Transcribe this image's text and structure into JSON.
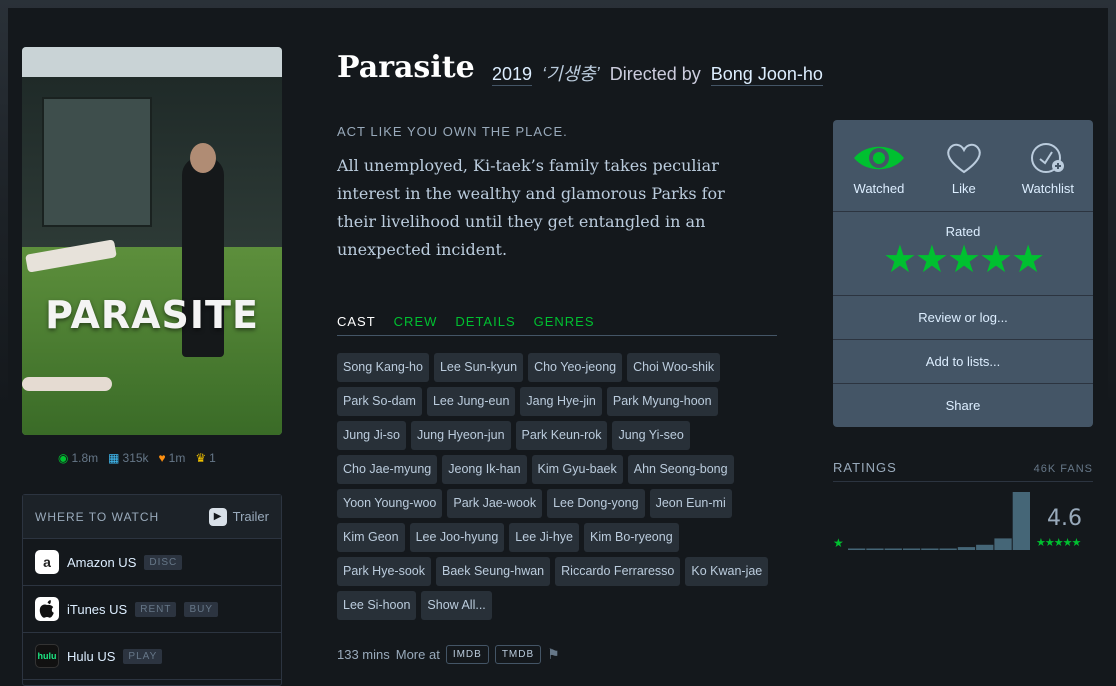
{
  "film": {
    "title": "Parasite",
    "year": "2019",
    "original_title": "‘기생충’",
    "directed_by_label": "Directed by",
    "director": "Bong Joon-ho",
    "tagline": "ACT LIKE YOU OWN THE PLACE.",
    "synopsis": "All unemployed, Ki-taek’s family takes peculiar interest in the wealthy and glamorous Parks for their livelihood until they get entangled in an unexpected incident."
  },
  "poster": {
    "title": "PARASITE"
  },
  "stats": {
    "watched": "1.8m",
    "lists": "315k",
    "likes": "1m",
    "top": "1"
  },
  "where_to_watch": {
    "title": "WHERE TO WATCH",
    "trailer_label": "Trailer",
    "services": [
      {
        "name": "Amazon US",
        "tags": [
          "DISC"
        ],
        "icon": "amazon-icon"
      },
      {
        "name": "iTunes US",
        "tags": [
          "RENT",
          "BUY"
        ],
        "icon": "apple-icon"
      },
      {
        "name": "Hulu US",
        "tags": [
          "PLAY"
        ],
        "icon": "hulu-icon"
      }
    ]
  },
  "tabs": [
    "CAST",
    "CREW",
    "DETAILS",
    "GENRES"
  ],
  "cast": [
    "Song Kang-ho",
    "Lee Sun-kyun",
    "Cho Yeo-jeong",
    "Choi Woo-shik",
    "Park So-dam",
    "Lee Jung-eun",
    "Jang Hye-jin",
    "Park Myung-hoon",
    "Jung Ji-so",
    "Jung Hyeon-jun",
    "Park Keun-rok",
    "Jung Yi-seo",
    "Cho Jae-myung",
    "Jeong Ik-han",
    "Kim Gyu-baek",
    "Ahn Seong-bong",
    "Yoon Young-woo",
    "Park Jae-wook",
    "Lee Dong-yong",
    "Jeon Eun-mi",
    "Kim Geon",
    "Lee Joo-hyung",
    "Lee Ji-hye",
    "Kim Bo-ryeong",
    "Park Hye-sook",
    "Baek Seung-hwan",
    "Riccardo Ferraresso",
    "Ko Kwan-jae",
    "Lee Si-hoon",
    "Show All..."
  ],
  "footer": {
    "runtime": "133 mins",
    "more_at": "More at",
    "imdb": "IMDB",
    "tmdb": "TMDB"
  },
  "panel": {
    "watched": "Watched",
    "like": "Like",
    "watchlist": "Watchlist",
    "rated": "Rated",
    "stars": "★★★★★",
    "user_rating": 5,
    "review": "Review or log...",
    "add_lists": "Add to lists...",
    "share": "Share"
  },
  "ratings": {
    "title": "RATINGS",
    "fans": "46K FANS",
    "average": "4.6",
    "min_star": "★",
    "max_stars": "★★★★★",
    "histogram": [
      0.5,
      0.5,
      0.5,
      1,
      1,
      2,
      5,
      9,
      20,
      100
    ]
  },
  "colors": {
    "accent_green": "#00c030",
    "panel": "#445566",
    "background": "#14181c"
  }
}
